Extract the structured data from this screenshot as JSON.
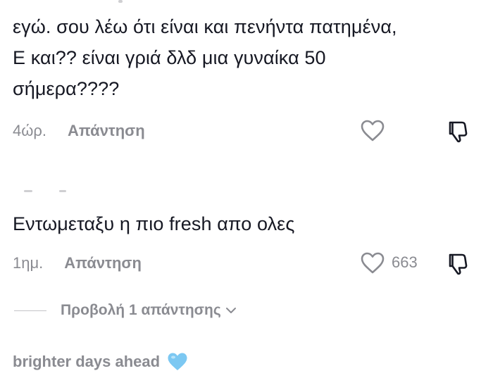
{
  "comments": [
    {
      "text_lines": [
        "εγώ. σου λέω ότι είναι και πενήντα πατημένα,",
        "Ε και?? είναι γριά δλδ μια γυναίκα 50",
        "σήμερα????"
      ],
      "timestamp": "4ώρ.",
      "reply_label": "Απάντηση",
      "like_count": ""
    },
    {
      "text_lines": [
        "Εντωμεταξυ η πιο fresh απο ολες"
      ],
      "timestamp": "1ημ.",
      "reply_label": "Απάντηση",
      "like_count": "663",
      "view_replies_label": "Προβολή 1 απάντησης"
    },
    {
      "username": "brighter days ahead",
      "username_emoji": "light-blue-heart-icon"
    }
  ],
  "colors": {
    "text": "#161823",
    "muted": "#8a8b91",
    "heart_emoji": "#7cc8f2"
  }
}
